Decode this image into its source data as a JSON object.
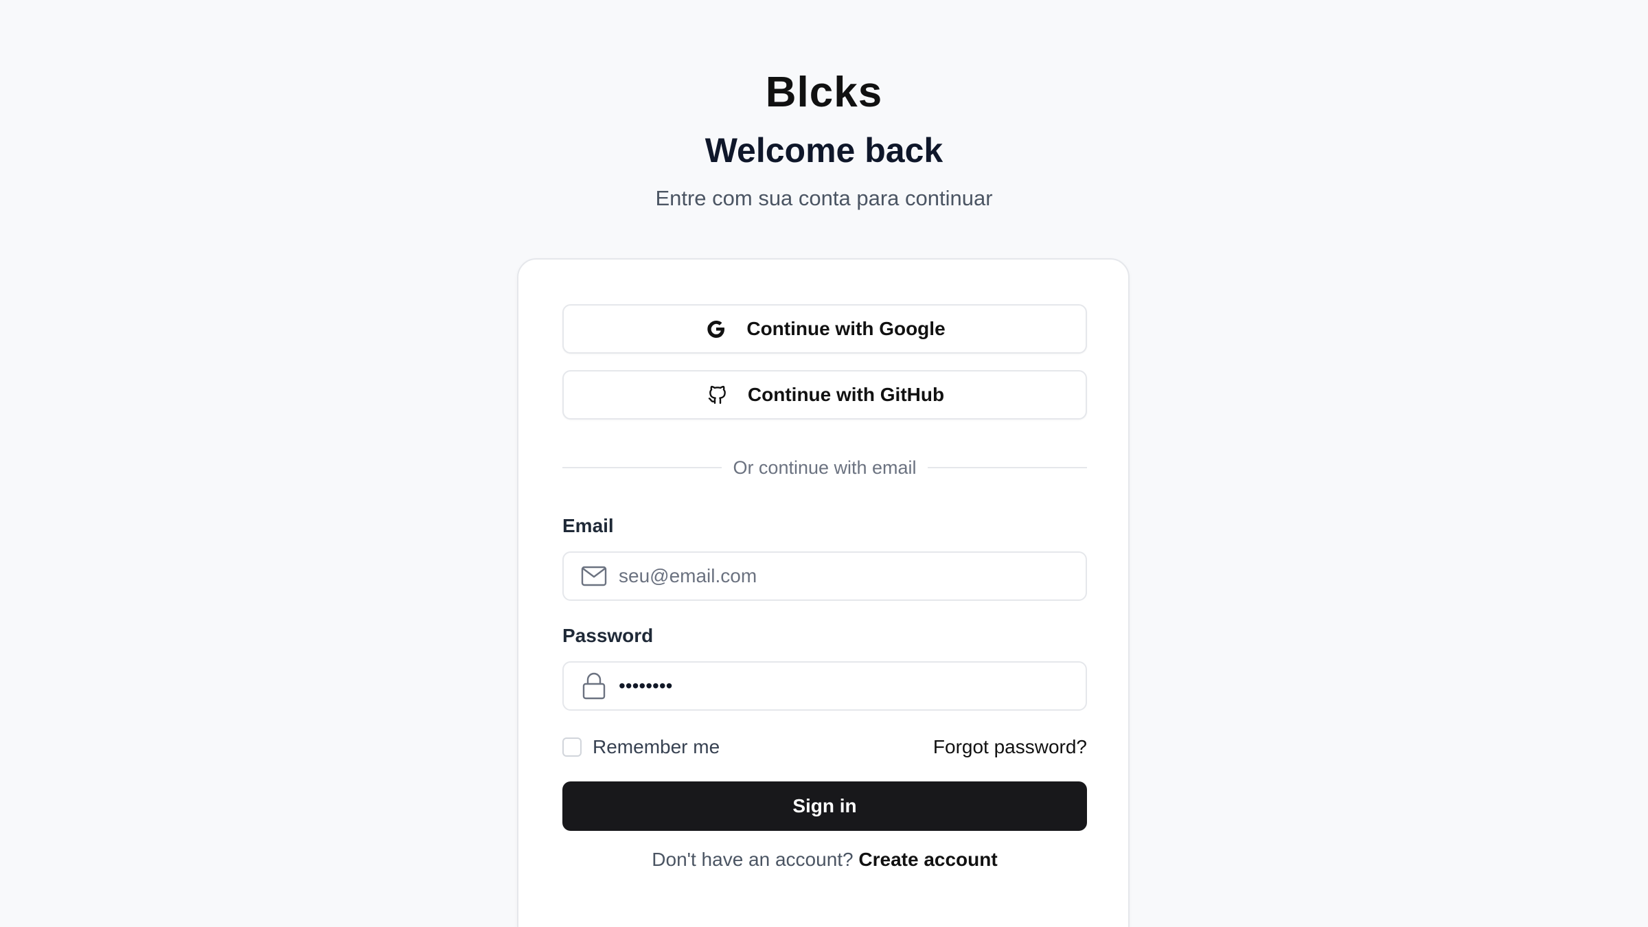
{
  "brand": "Blcks",
  "header": {
    "title": "Welcome back",
    "subtitle": "Entre com sua conta para continuar"
  },
  "oauth": {
    "google_label": "Continue with Google",
    "github_label": "Continue with GitHub"
  },
  "divider_text": "Or continue with email",
  "email": {
    "label": "Email",
    "placeholder": "seu@email.com",
    "value": ""
  },
  "password": {
    "label": "Password",
    "value": "password"
  },
  "remember_label": "Remember me",
  "forgot_label": "Forgot password?",
  "signin_label": "Sign in",
  "footer": {
    "prompt": "Don't have an account?",
    "create_label": "Create account"
  },
  "colors": {
    "background": "#f8f9fb",
    "primary_button": "#18181b",
    "border": "#e5e7eb",
    "muted_text": "#6b7280"
  },
  "icons": {
    "google": "google-icon",
    "github": "github-icon",
    "email": "mail-icon",
    "password": "lock-icon"
  }
}
